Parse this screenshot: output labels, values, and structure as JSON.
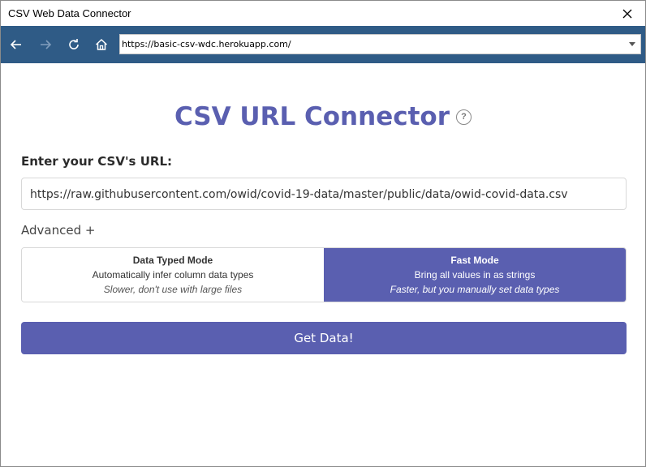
{
  "window": {
    "title": "CSV Web Data Connector"
  },
  "navbar": {
    "address": "https://basic-csv-wdc.herokuapp.com/",
    "icons": [
      "back-arrow-icon",
      "forward-arrow-icon",
      "refresh-icon",
      "home-icon",
      "chevron-down-icon"
    ]
  },
  "page": {
    "title": "CSV URL Connector",
    "help_symbol": "?",
    "url_label": "Enter your CSV's URL:",
    "url_value": "https://raw.githubusercontent.com/owid/covid-19-data/master/public/data/owid-covid-data.csv",
    "advanced_label": "Advanced +",
    "modes": [
      {
        "title": "Data Typed Mode",
        "description": "Automatically infer column data types",
        "note": "Slower, don't use with large files",
        "selected": false
      },
      {
        "title": "Fast Mode",
        "description": "Bring all values in as strings",
        "note": "Faster, but you manually set data types",
        "selected": true
      }
    ],
    "submit_label": "Get Data!"
  },
  "colors": {
    "navbar": "#2f5b86",
    "accent": "#5a5fb0"
  }
}
